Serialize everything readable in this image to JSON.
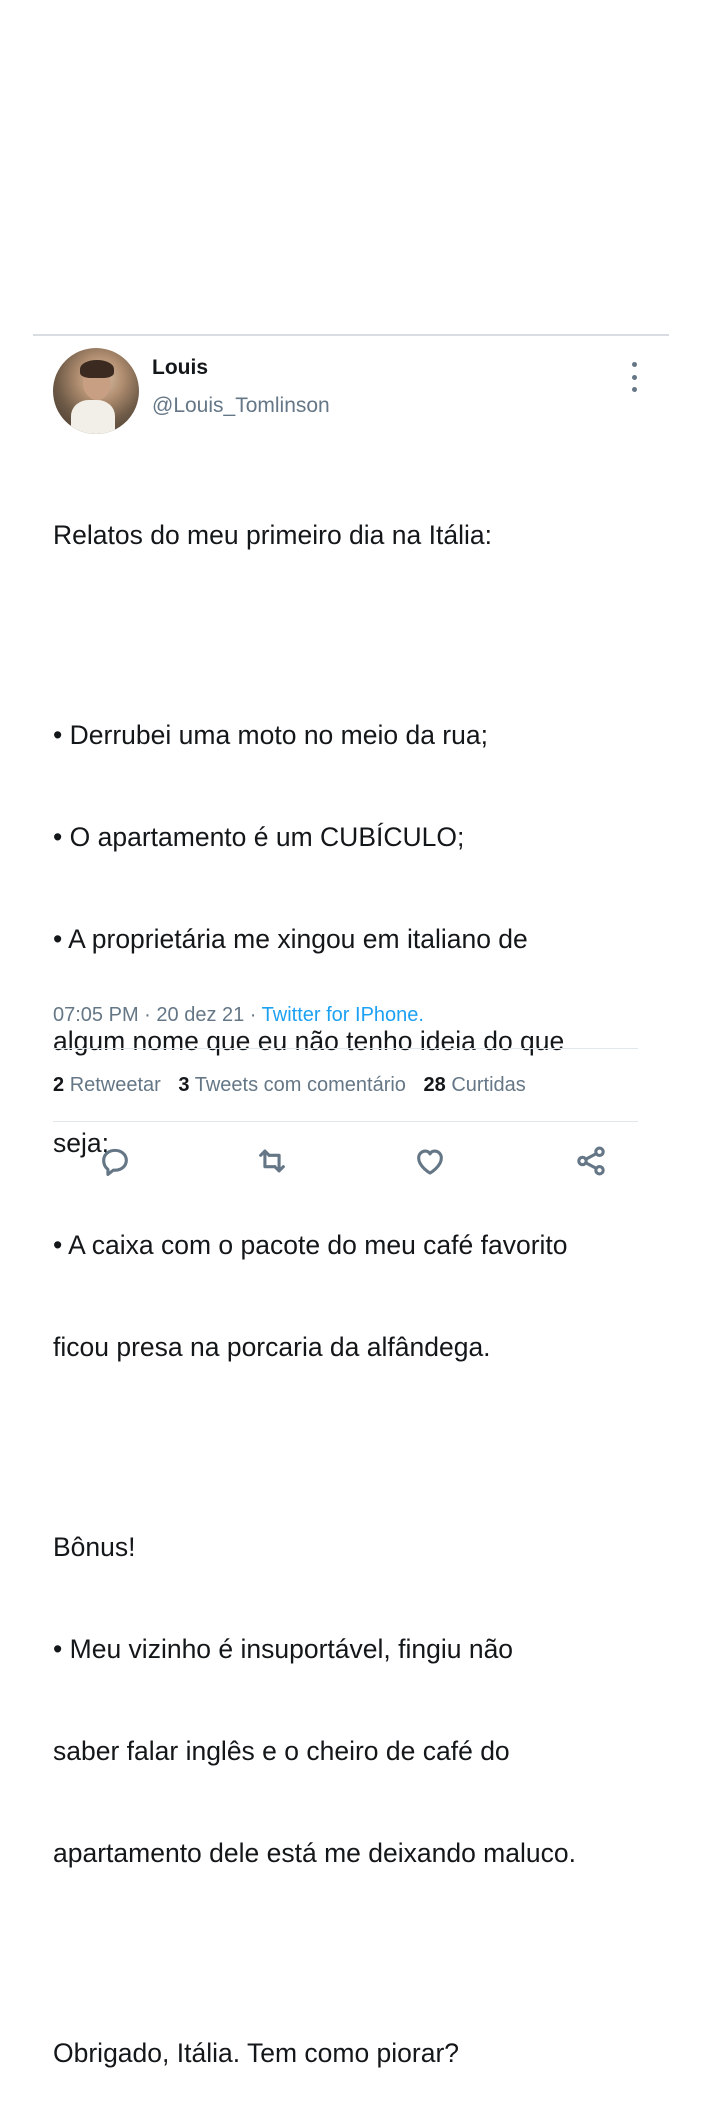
{
  "user": {
    "display_name": "Louis",
    "handle": "@Louis_Tomlinson"
  },
  "tweet": {
    "paragraphs": [
      [
        "Relatos do meu primeiro dia na Itália:"
      ],
      [
        "• Derrubei uma moto no meio da rua;",
        "• O apartamento é um CUBÍCULO;",
        "• A proprietária me xingou em italiano de",
        "algum nome que eu não tenho ideia do que",
        "seja;",
        "• A caixa com o pacote do meu café favorito",
        "ficou presa na porcaria da alfândega."
      ],
      [
        "Bônus!",
        "• Meu vizinho é insuportável, fingiu não",
        "saber falar inglês e o cheiro de café do",
        "apartamento dele está me deixando maluco."
      ],
      [
        "Obrigado, Itália. Tem como piorar?"
      ]
    ]
  },
  "meta": {
    "time": "07:05 PM",
    "date": "20 dez 21",
    "separator": " · ",
    "source": "Twitter for IPhone."
  },
  "stats": {
    "retweets_count": "2",
    "retweets_label": "Retweetar",
    "quotes_count": "3",
    "quotes_label": "Tweets com comentário",
    "likes_count": "28",
    "likes_label": "Curtidas"
  },
  "icons": {
    "more": "more-vertical-icon",
    "reply": "reply-icon",
    "retweet": "retweet-icon",
    "like": "heart-icon",
    "share": "share-icon"
  },
  "colors": {
    "text": "#14171a",
    "secondary": "#657786",
    "link": "#1da1f2",
    "divider": "#e1e8ed"
  }
}
